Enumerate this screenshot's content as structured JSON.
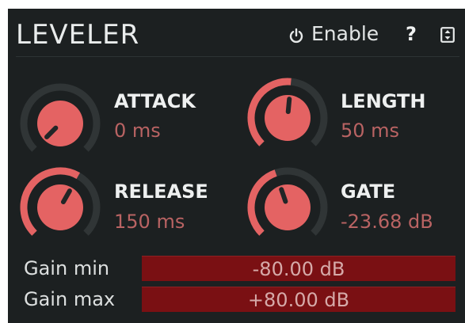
{
  "header": {
    "title": "LEVELER",
    "enable_label": "Enable",
    "help_label": "?",
    "icons": {
      "power": "power-icon",
      "menu": "menu-icon"
    }
  },
  "knobs": {
    "attack": {
      "label": "ATTACK",
      "value_text": "0 ms",
      "position": 0.0
    },
    "length": {
      "label": "LENGTH",
      "value_text": "50 ms",
      "position": 0.52
    },
    "release": {
      "label": "RELEASE",
      "value_text": "150 ms",
      "position": 0.61
    },
    "gate": {
      "label": "GATE",
      "value_text": "-23.68 dB",
      "position": 0.43
    }
  },
  "gain": {
    "min": {
      "label": "Gain min",
      "value_text": "-80.00 dB"
    },
    "max": {
      "label": "Gain max",
      "value_text": "+80.00 dB"
    }
  },
  "colors": {
    "background": "#1c2021",
    "knob_fill": "#e46363",
    "knob_track": "#303536",
    "knob_pointer": "#222627",
    "value_text": "#b96363",
    "gain_bar": "#7a1013"
  }
}
